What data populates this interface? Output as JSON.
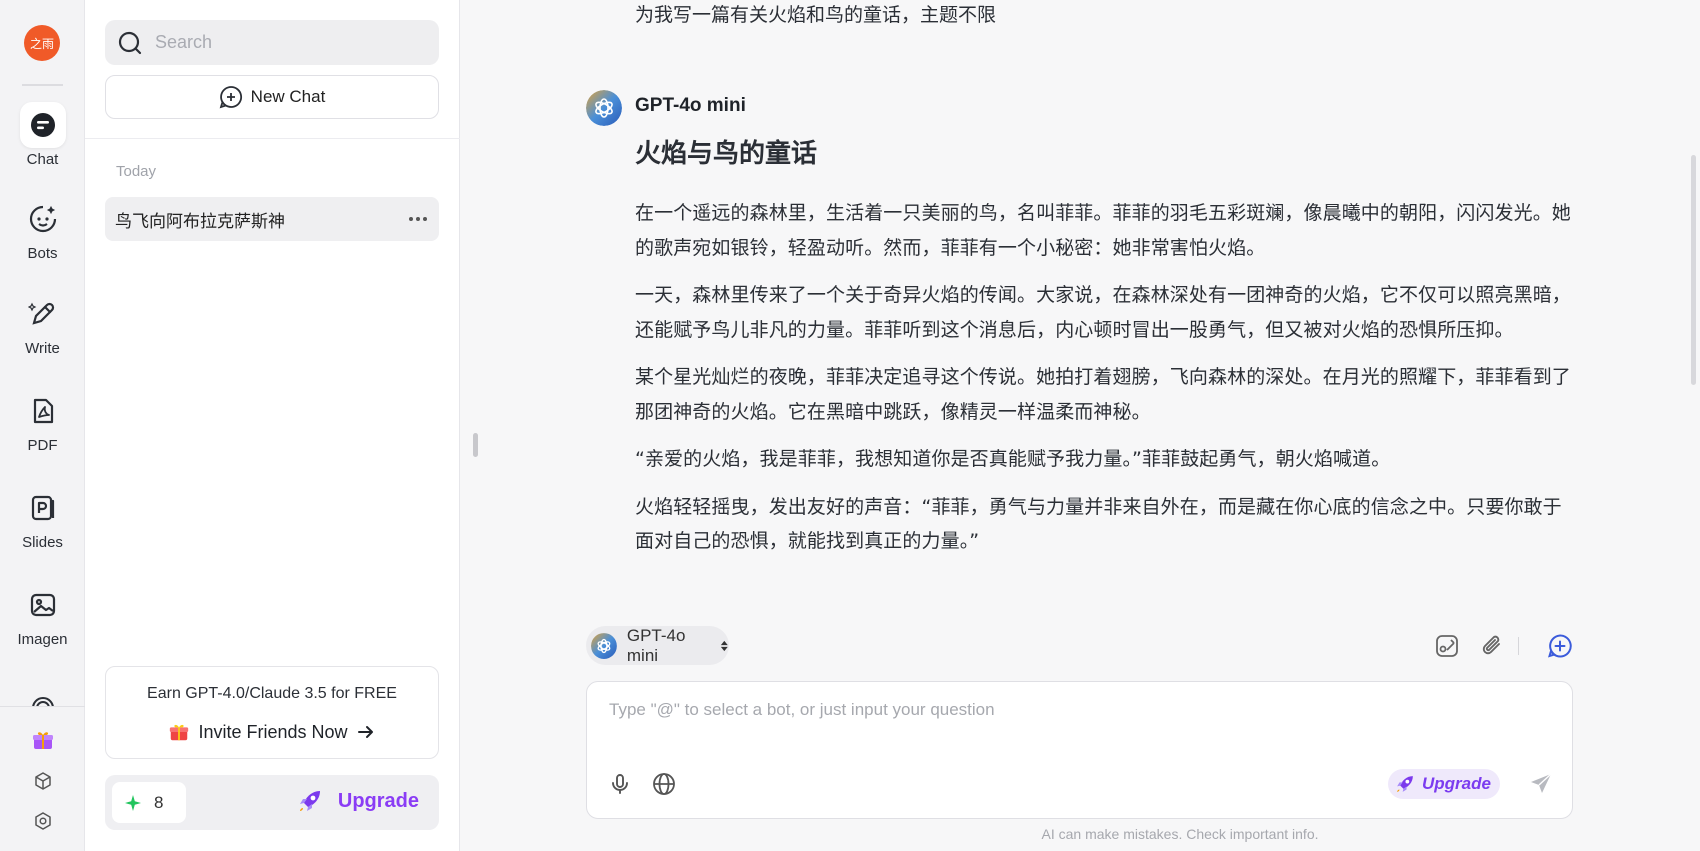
{
  "rail": {
    "logo_text": "之雨",
    "items": [
      {
        "label": "Chat",
        "icon": "chat-icon",
        "active": true
      },
      {
        "label": "Bots",
        "icon": "bot-icon"
      },
      {
        "label": "Write",
        "icon": "pen-icon"
      },
      {
        "label": "PDF",
        "icon": "pdf-icon"
      },
      {
        "label": "Slides",
        "icon": "slides-icon"
      },
      {
        "label": "Imagen",
        "icon": "image-icon"
      }
    ],
    "bottom": [
      "gift-icon",
      "cube-icon",
      "settings-icon"
    ]
  },
  "sidebar": {
    "search_placeholder": "Search",
    "new_chat_label": "New Chat",
    "section_today": "Today",
    "chats": [
      {
        "title": "鸟飞向阿布拉克萨斯神"
      }
    ],
    "promo": {
      "title": "Earn GPT-4.0/Claude 3.5 for FREE",
      "link": "Invite Friends Now"
    },
    "credits": "8",
    "upgrade_label": "Upgrade"
  },
  "conversation": {
    "user_message": "为我写一篇有关火焰和鸟的童话，主题不限",
    "bot_name": "GPT-4o mini",
    "story_title": "火焰与鸟的童话",
    "paragraphs": [
      "在一个遥远的森林里，生活着一只美丽的鸟，名叫菲菲。菲菲的羽毛五彩斑斓，像晨曦中的朝阳，闪闪发光。她的歌声宛如银铃，轻盈动听。然而，菲菲有一个小秘密：她非常害怕火焰。",
      "一天，森林里传来了一个关于奇异火焰的传闻。大家说，在森林深处有一团神奇的火焰，它不仅可以照亮黑暗，还能赋予鸟儿非凡的力量。菲菲听到这个消息后，内心顿时冒出一股勇气，但又被对火焰的恐惧所压抑。",
      "某个星光灿烂的夜晚，菲菲决定追寻这个传说。她拍打着翅膀，飞向森林的深处。在月光的照耀下，菲菲看到了那团神奇的火焰。它在黑暗中跳跃，像精灵一样温柔而神秘。",
      "“亲爱的火焰，我是菲菲，我想知道你是否真能赋予我力量。”菲菲鼓起勇气，朝火焰喊道。",
      "火焰轻轻摇曳，发出友好的声音：“菲菲，勇气与力量并非来自外在，而是藏在你心底的信念之中。只要你敢于面对自己的恐惧，就能找到真正的力量。”"
    ]
  },
  "composer": {
    "model_label": "GPT-4o mini",
    "placeholder": "Type \"@\" to select a bot, or just input your question",
    "upgrade_label": "Upgrade",
    "disclaimer": "AI can make mistakes. Check important info."
  },
  "colors": {
    "accent": "#7b3cf0",
    "logo": "#f05a28",
    "new_chat_blue": "#3b5bdb"
  }
}
